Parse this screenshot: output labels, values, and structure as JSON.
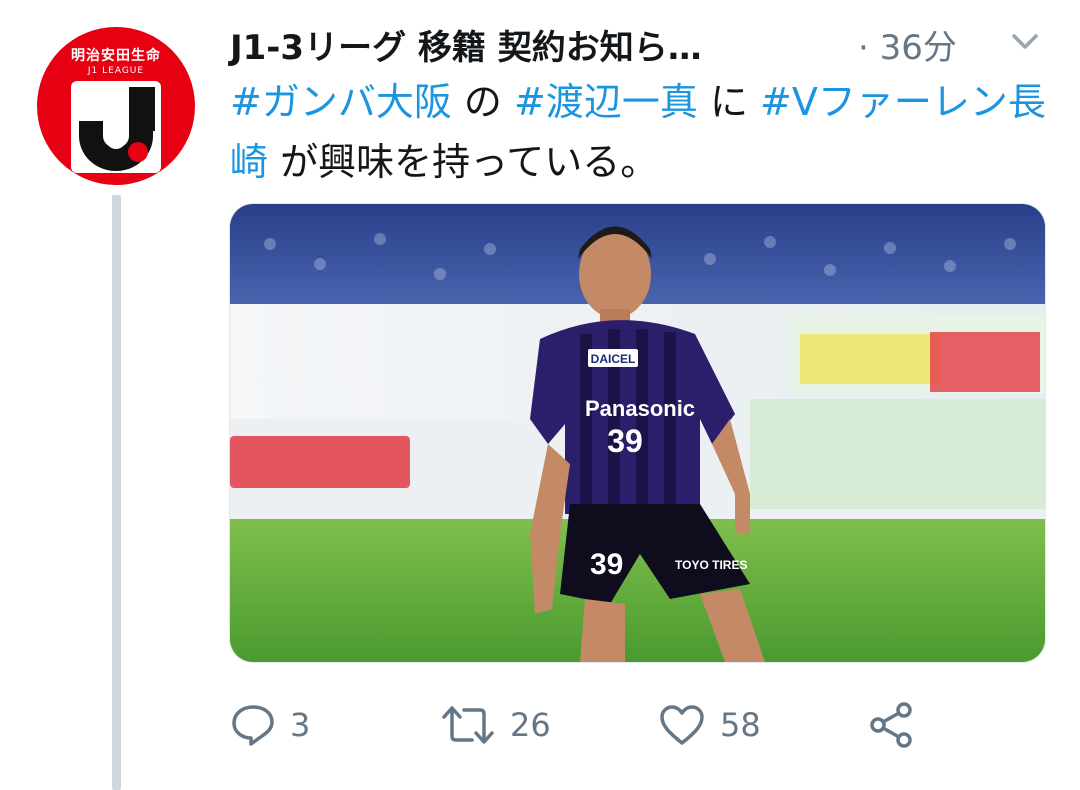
{
  "tweet": {
    "account_name": "J1-3リーグ 移籍 契約お知ら…",
    "time": "· 36分",
    "text_parts": [
      {
        "text": "#ガンバ大阪",
        "hashtag": true
      },
      {
        "text": " の ",
        "hashtag": false
      },
      {
        "text": "#渡辺一真",
        "hashtag": true
      },
      {
        "text": " に ",
        "hashtag": false
      },
      {
        "text": "#Vファーレン長崎",
        "hashtag": true
      },
      {
        "text": " が興味を持っている。",
        "hashtag": false
      }
    ]
  },
  "avatar": {
    "brand": "明治安田生命",
    "league": "J1 LEAGUE"
  },
  "photo": {
    "sponsor": "Panasonic",
    "shirt_number": "39",
    "sleeve": "DAICEL",
    "shorts_sponsor": "TOYO TIRES"
  },
  "actions": {
    "reply_count": "3",
    "retweet_count": "26",
    "like_count": "58"
  },
  "colors": {
    "hashtag": "#1b95e0",
    "meta": "#657786",
    "avatar_bg": "#e60012"
  },
  "icons": [
    "reply-icon",
    "retweet-icon",
    "like-icon",
    "share-icon",
    "chevron-down-icon"
  ]
}
